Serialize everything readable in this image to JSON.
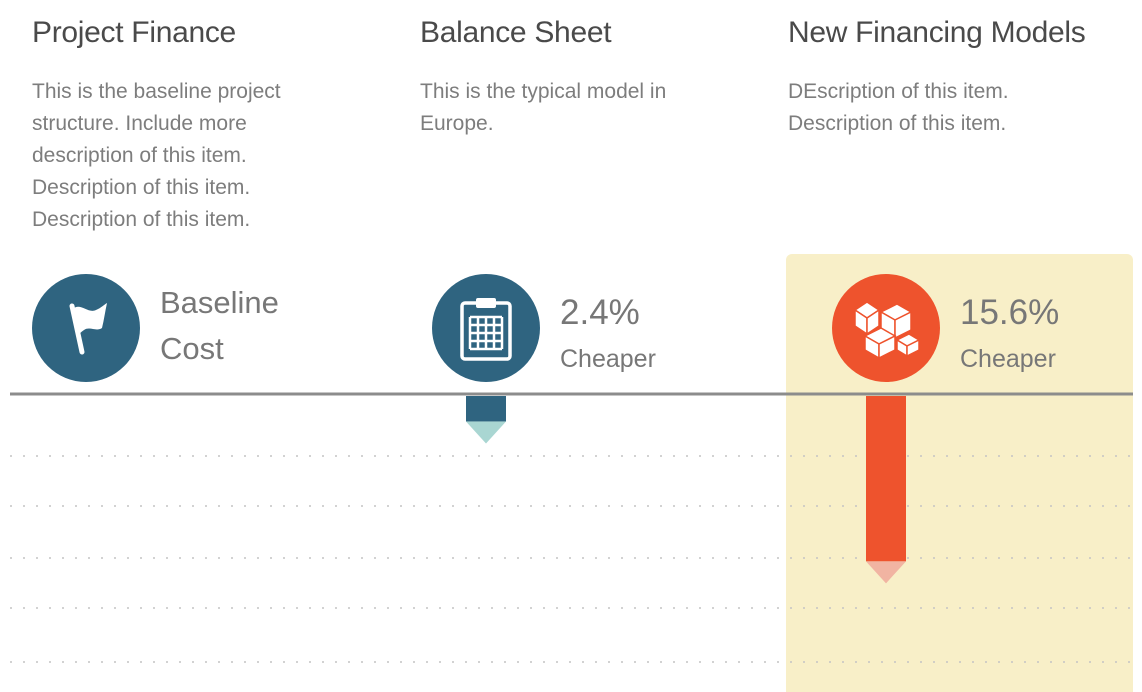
{
  "columns": [
    {
      "title": "Project Finance",
      "description": "This is the baseline project structure. Include more description of this item. Description of this item. Description of this item.",
      "stat_line1": "Baseline",
      "stat_line2": "Cost",
      "icon": "flag-icon",
      "color": "#2f6480"
    },
    {
      "title": "Balance Sheet",
      "description": "This is the typical model in Europe.",
      "stat_line1": "2.4%",
      "stat_line2": "Cheaper",
      "icon": "clipboard-grid-icon",
      "color": "#2f6480"
    },
    {
      "title": "New Financing Models",
      "description": "DEscription of this item. Description of this item.",
      "stat_line1": "15.6%",
      "stat_line2": "Cheaper",
      "icon": "cubes-icon",
      "color": "#ee532d",
      "highlighted": true
    }
  ],
  "chart_data": {
    "type": "bar",
    "categories": [
      "Project Finance",
      "Balance Sheet",
      "New Financing Models"
    ],
    "values": [
      0,
      2.4,
      15.6
    ],
    "unit": "% cheaper",
    "ylim": [
      0,
      18
    ],
    "grid": true,
    "bar_colors": [
      "#2f6480",
      "#2f6480",
      "#ee532d"
    ],
    "arrow_colors": [
      "#a9d6d2",
      "#a9d6d2",
      "#f1b4a2"
    ],
    "baseline_color": "#8c8c8c",
    "highlight_color": "#f8efc8"
  }
}
